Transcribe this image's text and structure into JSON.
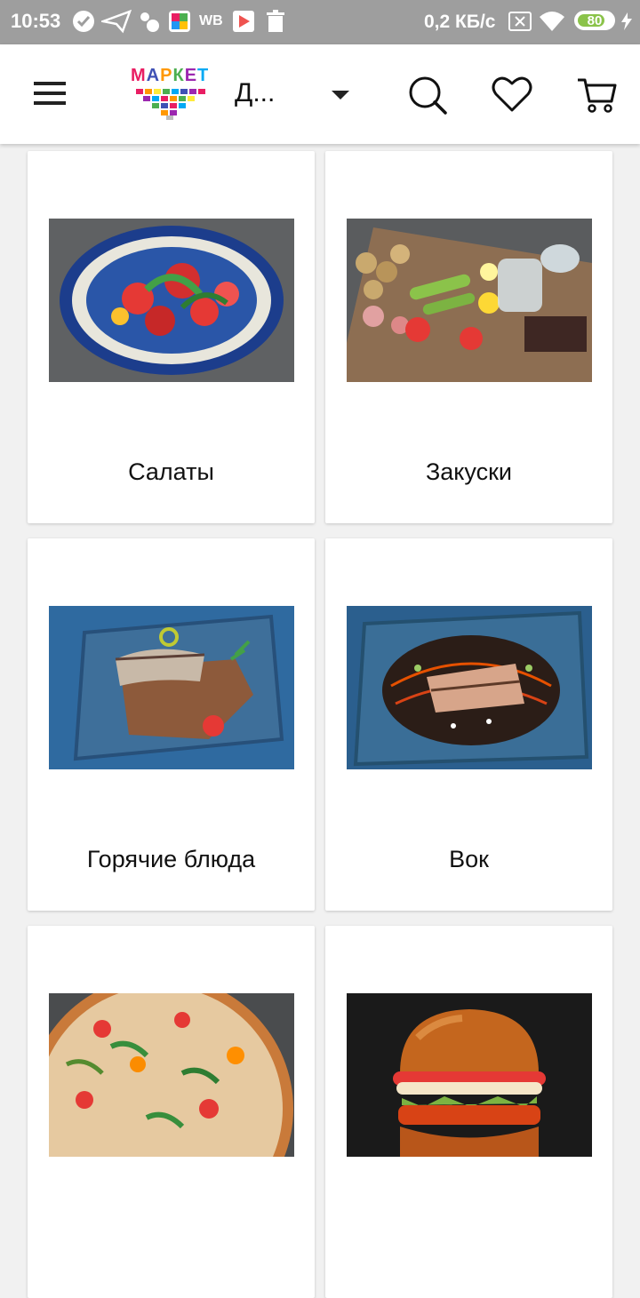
{
  "status_bar": {
    "time": "10:53",
    "network_speed": "0,2 КБ/с",
    "battery": "80",
    "battery_level": 80,
    "icons": [
      "check-circle-icon",
      "send-icon",
      "cloud-icon",
      "colorful-app-icon",
      "wb-label",
      "play-store-icon",
      "trash-icon",
      "sim-icon",
      "wifi-icon",
      "charging-icon"
    ],
    "wb_label": "WB"
  },
  "header": {
    "logo_text": "МАРКЕТ",
    "store_name": "Д...",
    "icons": [
      "menu-icon",
      "chevron-down-icon",
      "search-icon",
      "heart-icon",
      "cart-icon"
    ]
  },
  "categories": [
    {
      "title": "Салаты",
      "image": "salad-photo"
    },
    {
      "title": "Закуски",
      "image": "appetizers-photo"
    },
    {
      "title": "Горячие блюда",
      "image": "hot-dish-photo"
    },
    {
      "title": "Вок",
      "image": "wok-photo"
    },
    {
      "title": "",
      "image": "pizza-photo"
    },
    {
      "title": "",
      "image": "burger-photo"
    }
  ],
  "colors": {
    "status_bar_bg": "#9e9e9e",
    "page_bg": "#f1f1f1",
    "battery_green": "#8bc34a"
  }
}
